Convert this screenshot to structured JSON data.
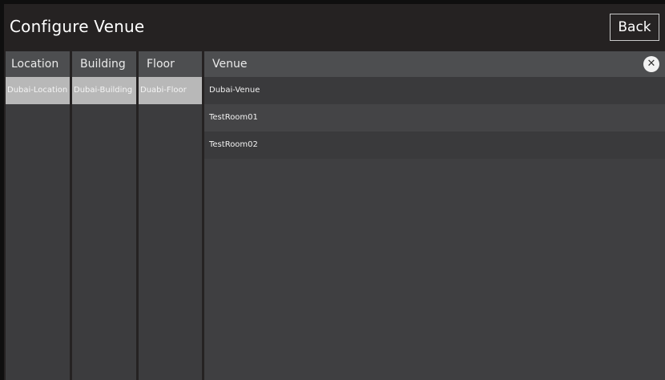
{
  "header": {
    "title": "Configure Venue",
    "back_label": "Back"
  },
  "columns": {
    "location": {
      "header": "Location",
      "items": [
        "Dubai-Location"
      ],
      "selected": "Dubai-Location"
    },
    "building": {
      "header": "Building",
      "items": [
        "Dubai-Building"
      ],
      "selected": "Dubai-Building"
    },
    "floor": {
      "header": "Floor",
      "items": [
        "Duabi-Floor"
      ],
      "selected": "Duabi-Floor"
    },
    "venue": {
      "header": "Venue",
      "items": [
        "Dubai-Venue",
        "TestRoom01",
        "TestRoom02"
      ]
    }
  },
  "icons": {
    "close": "close-icon"
  },
  "colors": {
    "background": "#252222",
    "column_bg": "#3c3c3e",
    "column_header_bg": "#4d4e50",
    "selected_bg": "#b8b8b8"
  }
}
